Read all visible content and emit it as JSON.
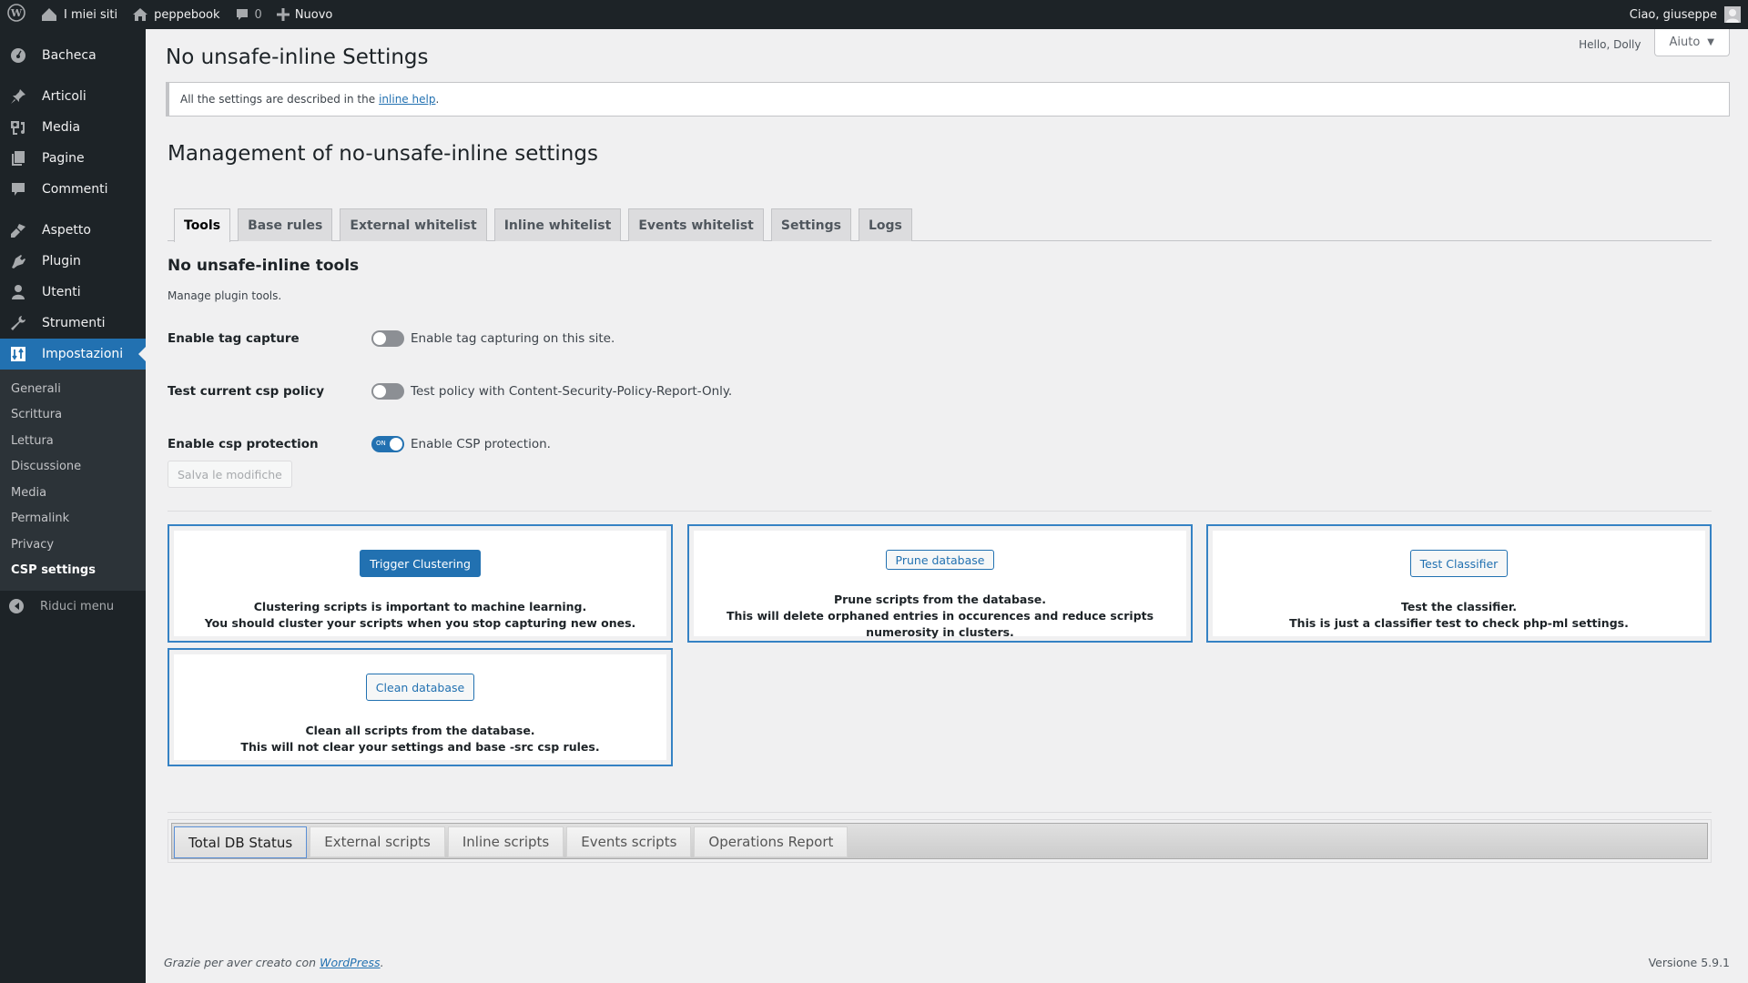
{
  "adminbar": {
    "wp_logo": "wordpress-logo-icon",
    "my_sites": "I miei siti",
    "site_name": "peppebook",
    "comments_count": "0",
    "new_label": "Nuovo",
    "greeting": "Ciao, giuseppe"
  },
  "sidebar": {
    "items": [
      {
        "label": "Bacheca",
        "icon": "dashboard-icon"
      },
      {
        "label": "Articoli",
        "icon": "pin-icon"
      },
      {
        "label": "Media",
        "icon": "media-icon"
      },
      {
        "label": "Pagine",
        "icon": "pages-icon"
      },
      {
        "label": "Commenti",
        "icon": "comment-icon"
      },
      {
        "label": "Aspetto",
        "icon": "brush-icon"
      },
      {
        "label": "Plugin",
        "icon": "plugin-icon"
      },
      {
        "label": "Utenti",
        "icon": "user-icon"
      },
      {
        "label": "Strumenti",
        "icon": "wrench-icon"
      },
      {
        "label": "Impostazioni",
        "icon": "settings-icon"
      }
    ],
    "submenu": [
      "Generali",
      "Scrittura",
      "Lettura",
      "Discussione",
      "Media",
      "Permalink",
      "Privacy",
      "CSP settings"
    ],
    "collapse_label": "Riduci menu"
  },
  "screen_meta": {
    "hello_dolly": "Hello, Dolly",
    "help_label": "Aiuto"
  },
  "page": {
    "title": "No unsafe-inline Settings",
    "notice_text": "All the settings are described in the",
    "notice_link": "inline help",
    "notice_end": ".",
    "section_title": "Management of no-unsafe-inline settings",
    "tabs": [
      "Tools",
      "Base rules",
      "External whitelist",
      "Inline whitelist",
      "Events whitelist",
      "Settings",
      "Logs"
    ],
    "active_tab": "Tools",
    "tools_title": "No unsafe-inline tools",
    "tools_desc": "Manage plugin tools.",
    "settings": [
      {
        "label": "Enable tag capture",
        "description": "Enable tag capturing on this site.",
        "enabled": false
      },
      {
        "label": "Test current csp policy",
        "description": "Test policy with Content-Security-Policy-Report-Only.",
        "enabled": false
      },
      {
        "label": "Enable csp protection",
        "description": "Enable CSP protection.",
        "enabled": true,
        "on_text": "ON"
      }
    ],
    "save_label": "Salva le modifiche",
    "tools": [
      {
        "button": "Trigger Clustering",
        "line1": "Clustering scripts is important to machine learning.",
        "line2": "You should cluster your scripts when you stop capturing new ones."
      },
      {
        "button": "Prune database",
        "line1": "Prune scripts from the database.",
        "line2": "This will delete orphaned entries in occurences and reduce scripts numerosity in clusters."
      },
      {
        "button": "Test Classifier",
        "line1": "Test the classifier.",
        "line2": "This is just a classifier test to check php-ml settings."
      },
      {
        "button": "Clean database",
        "line1": "Clean all scripts from the database.",
        "line2": "This will not clear your settings and base -src csp rules."
      }
    ],
    "status_tabs": [
      "Total DB Status",
      "External scripts",
      "Inline scripts",
      "Events scripts",
      "Operations Report"
    ],
    "active_status_tab": "Total DB Status"
  },
  "footer": {
    "thanks_text": "Grazie per aver creato con",
    "thanks_link": "WordPress",
    "thanks_end": ".",
    "version": "Versione 5.9.1"
  },
  "colors": {
    "accent": "#2271b1",
    "adminbar_bg": "#1d2327",
    "box_border": "#3582c4",
    "page_bg": "#f0f0f1"
  }
}
